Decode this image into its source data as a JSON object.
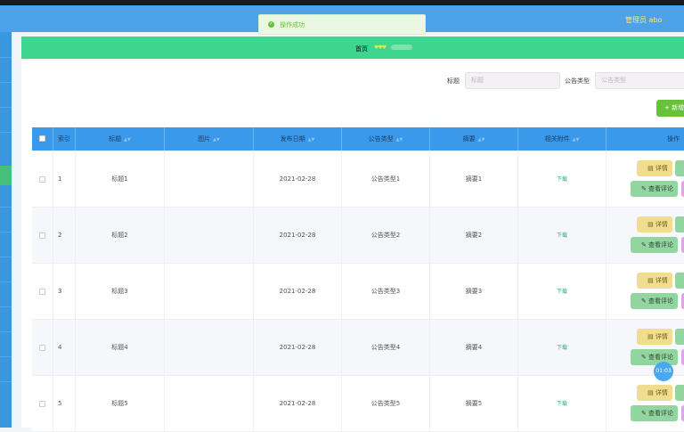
{
  "header": {
    "title_visible_left": "",
    "title_visible_right": "",
    "admin_text": "管理员 abo",
    "logout_text": ""
  },
  "toast": {
    "message": "操作成功"
  },
  "breadcrumb": {
    "home": "首页"
  },
  "search": {
    "title_label": "标题",
    "title_placeholder": "标题",
    "type_label": "公告类型",
    "type_placeholder": "公告类型"
  },
  "actions": {
    "add_label": "+ 新增"
  },
  "table": {
    "columns": [
      "索引",
      "标题",
      "图片",
      "发布日期",
      "公告类型",
      "摘要",
      "相关附件",
      "操作"
    ],
    "rows": [
      {
        "index": "1",
        "title": "标题1",
        "date": "2021-02-28",
        "type": "公告类型1",
        "summary": "摘要1",
        "attachment": "下载"
      },
      {
        "index": "2",
        "title": "标题2",
        "date": "2021-02-28",
        "type": "公告类型2",
        "summary": "摘要2",
        "attachment": "下载"
      },
      {
        "index": "3",
        "title": "标题3",
        "date": "2021-02-28",
        "type": "公告类型3",
        "summary": "摘要3",
        "attachment": "下载"
      },
      {
        "index": "4",
        "title": "标题4",
        "date": "2021-02-28",
        "type": "公告类型4",
        "summary": "摘要4",
        "attachment": "下载"
      },
      {
        "index": "5",
        "title": "标题5",
        "date": "2021-02-28",
        "type": "公告类型5",
        "summary": "摘要5",
        "attachment": "下载"
      }
    ],
    "row_buttons": {
      "detail": "详情",
      "comments": "查看评论"
    }
  },
  "timer": {
    "text": "01:03"
  },
  "colors": {
    "header": "#4ca1e8",
    "breadcrumb_bar": "#3ed68e",
    "table_header": "#3a99ea",
    "add_button": "#67c23a"
  },
  "icons": {
    "toast": "check-circle-icon",
    "sort": "sort-icon",
    "detail": "document-icon",
    "comments": "edit-icon"
  }
}
